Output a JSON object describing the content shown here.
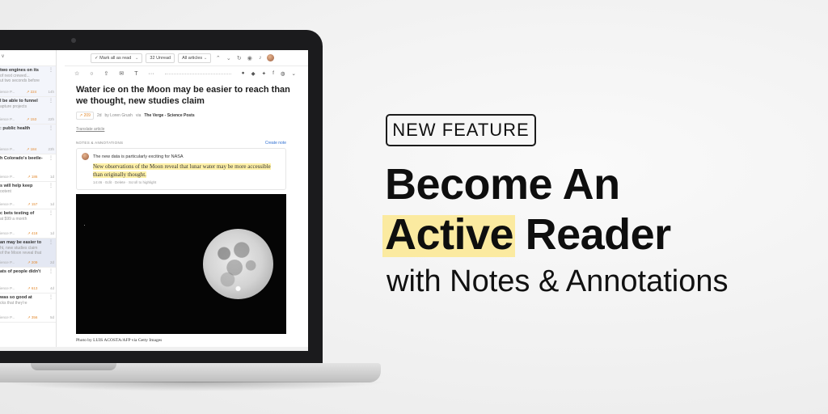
{
  "promo": {
    "badge": "NEW FEATURE",
    "headline_line1": "Become An",
    "headline_highlight": "Active",
    "headline_rest": " Reader",
    "subline": "with Notes & Annotations",
    "highlight_color": "#fbeaa0"
  },
  "feed_list": {
    "topbar": "v",
    "items": [
      {
        "title": "two engines on its",
        "snippet": "of next crewed...",
        "snippet2": "ut two seconds before",
        "source": "ience P...",
        "count": "224",
        "time": "14h",
        "tint": true
      },
      {
        "title": "l be able to funnel",
        "snippet": "apture projects",
        "snippet2": "",
        "source": "ience P...",
        "count": "153",
        "time": "22h",
        "tint": true
      },
      {
        "title": ": public health",
        "snippet": "",
        "snippet2": "",
        "source": "ience P...",
        "count": "184",
        "time": "23h",
        "tint": true
      },
      {
        "title": "h Colorado's beetle-",
        "snippet": "",
        "snippet2": "",
        "source": "ience P...",
        "count": "186",
        "time": "1d",
        "tint": false
      },
      {
        "title": "s will help keep",
        "snippet": "ootent",
        "snippet2": "",
        "source": "ience P...",
        "count": "157",
        "time": "1d",
        "tint": false
      },
      {
        "title": "c bets testing of",
        "snippet": "at $99 a month",
        "snippet2": "",
        "source": "ience P...",
        "count": "418",
        "time": "1d",
        "tint": false
      },
      {
        "title": "an may be easier to",
        "snippet": "ht, new studies claim",
        "snippet2": "of the Moon reveal that",
        "source": "ience P...",
        "count": "209",
        "time": "2d",
        "tint": false,
        "selected": true
      },
      {
        "title": "ats of people didn't",
        "snippet": "",
        "snippet2": "",
        "source": "ience P...",
        "count": "613",
        "time": "4d",
        "tint": false
      },
      {
        "title": "was so good at",
        "snippet": "cks that they're",
        "snippet2": "",
        "source": "ience P...",
        "count": "356",
        "time": "5d",
        "tint": false
      }
    ]
  },
  "toolbar": {
    "mark_all_read": "Mark all as read",
    "unread": "32 Unread",
    "all_articles": "All articles"
  },
  "article": {
    "title": "Water ice on the Moon may be easier to reach than we thought, new studies claim",
    "count": "209",
    "age": "2d",
    "by": "by Loren Grush",
    "via": "via",
    "source": "The Verge - Science Posts",
    "translate": "Translate article",
    "photo_caption": "Photo by LUIS ACOSTA/AFP via Getty Images"
  },
  "notes": {
    "header": "NOTES & ANNOTATIONS",
    "create": "Create note",
    "note_text": "The new data is particularly exciting for NASA",
    "highlight_text": "New observations of the Moon reveal that lunar water may be more accessible than originally thought.",
    "footer": "14:46 · Edit · Delete · Scroll to highlight"
  }
}
